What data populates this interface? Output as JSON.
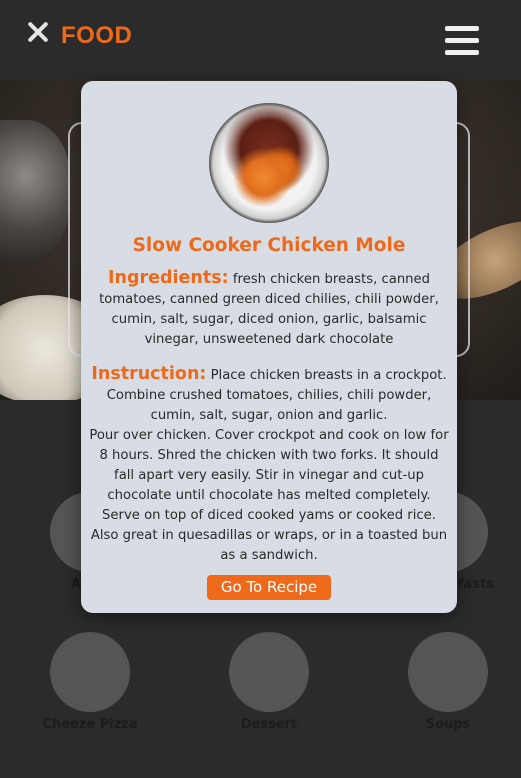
{
  "header": {
    "brand": "FOOD",
    "close_icon": "close-x-icon",
    "menu_icon": "hamburger-menu-icon"
  },
  "categories": [
    {
      "label": "Appetizers",
      "visible_label": "Appe"
    },
    {
      "label": "Breakfasts",
      "visible_label": "fasts"
    },
    {
      "label": "Cheeze Pizza"
    },
    {
      "label": "Dessert"
    },
    {
      "label": "Soups"
    }
  ],
  "modal": {
    "title": "Slow Cooker Chicken Mole",
    "ingredients_label": "Ingredients:",
    "ingredients_text": "fresh chicken breasts, canned tomatoes, canned green diced chilies, chili powder, cumin, salt, sugar, diced onion, garlic, balsamic vinegar, unsweetened dark chocolate",
    "instruction_label": "Instruction:",
    "instruction_intro": "Place chicken breasts in a crockpot.",
    "instruction_paragraphs": [
      "Combine crushed tomatoes, chilies, chili powder, cumin, salt, sugar, onion and garlic.",
      "Pour over chicken. Cover crockpot and cook on low for 8 hours. Shred the chicken with two forks. It should fall apart very easily. Stir in vinegar and cut-up chocolate until chocolate has melted completely.",
      "Serve on top of diced cooked yams or cooked rice. Also great in quesadillas or wraps, or in a toasted bun as a sandwich."
    ],
    "button_label": "Go To Recipe"
  },
  "colors": {
    "accent": "#ee6a1a",
    "header_bg": "#2b2b2b",
    "modal_bg": "#d8dce4"
  }
}
